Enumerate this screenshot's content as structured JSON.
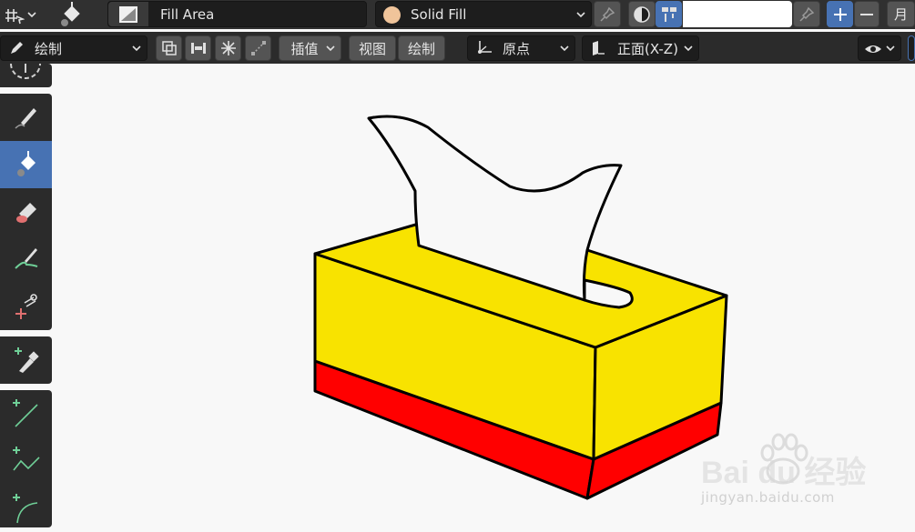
{
  "topbar": {
    "fill_area_label": "Fill Area",
    "material_label": "Solid Fill",
    "material_color": "#f0c49a",
    "layer_input_value": "",
    "cut_off_label": "月"
  },
  "tool_header": {
    "mode_label": "绘制",
    "interpolate_label": "插值",
    "view_label": "视图",
    "draw_label": "绘制",
    "origin_label": "原点",
    "orientation_label": "正面(X-Z)"
  },
  "toolbar": {
    "active_tool": "fill",
    "tools": [
      "draw",
      "fill",
      "erase",
      "tint",
      "cutter",
      "eyedropper",
      "line",
      "polyline",
      "arc"
    ]
  },
  "canvas": {
    "box_top_color": "#f8e300",
    "box_bottom_color": "#ff0000",
    "tissue_color": "#f8f8f8",
    "outline_color": "#000000"
  },
  "watermark": {
    "brand": "Bai du 经验",
    "url": "jingyan.baidu.com"
  },
  "colors": {
    "accent": "#4772b3",
    "header": "#303030",
    "field": "#1d1d1d",
    "button": "#545454"
  }
}
